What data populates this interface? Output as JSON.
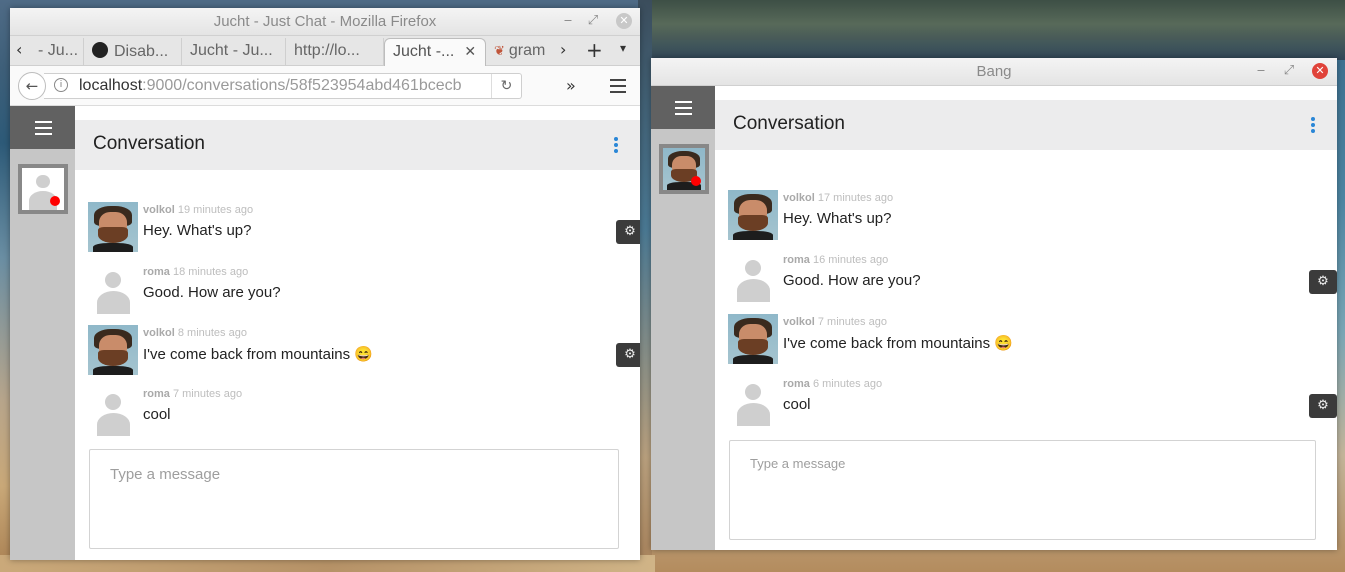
{
  "firefox": {
    "window_title": "Jucht - Just Chat - Mozilla Firefox",
    "tabs": [
      {
        "label": "- Ju..."
      },
      {
        "label": "Disab..."
      },
      {
        "label": "Jucht - Ju..."
      },
      {
        "label": "http://lo..."
      },
      {
        "label": "Jucht -..."
      },
      {
        "label": "gram"
      }
    ],
    "url_host": "localhost",
    "url_rest": ":9000/conversations/58f523954abd461bcecb",
    "new_tab": "+",
    "tab_scroll_left": "‹",
    "tab_scroll_right": "›",
    "tab_list": "▾",
    "overflow": "»"
  },
  "ff_chat": {
    "header_title": "Conversation",
    "messages": [
      {
        "author": "volkol",
        "time": "19 minutes ago",
        "text": "Hey. What's up?"
      },
      {
        "author": "roma",
        "time": "18 minutes ago",
        "text": "Good. How are you?"
      },
      {
        "author": "volkol",
        "time": "8 minutes ago",
        "text": "I've come back from mountains 😄"
      },
      {
        "author": "roma",
        "time": "7 minutes ago",
        "text": "cool"
      }
    ],
    "compose_placeholder": "Type a message"
  },
  "bang": {
    "window_title": "Bang"
  },
  "bang_chat": {
    "header_title": "Conversation",
    "messages": [
      {
        "author": "volkol",
        "time": "17 minutes ago",
        "text": "Hey. What's up?"
      },
      {
        "author": "roma",
        "time": "16 minutes ago",
        "text": "Good. How are you?"
      },
      {
        "author": "volkol",
        "time": "7 minutes ago",
        "text": "I've come back from mountains 😄"
      },
      {
        "author": "roma",
        "time": "6 minutes ago",
        "text": "cool"
      }
    ],
    "compose_placeholder": "Type a message"
  },
  "colors": {
    "rail": "#c6c6c6",
    "hamburger_bg": "#616161",
    "header_bg": "#ececed",
    "kebab": "#2a86d6",
    "online_dot": "#ff0000",
    "gear_bg": "#3b3b3b"
  },
  "icons": {
    "gear": "⚙",
    "close": "✕",
    "reload": "↻",
    "back": "←",
    "info": "i"
  }
}
